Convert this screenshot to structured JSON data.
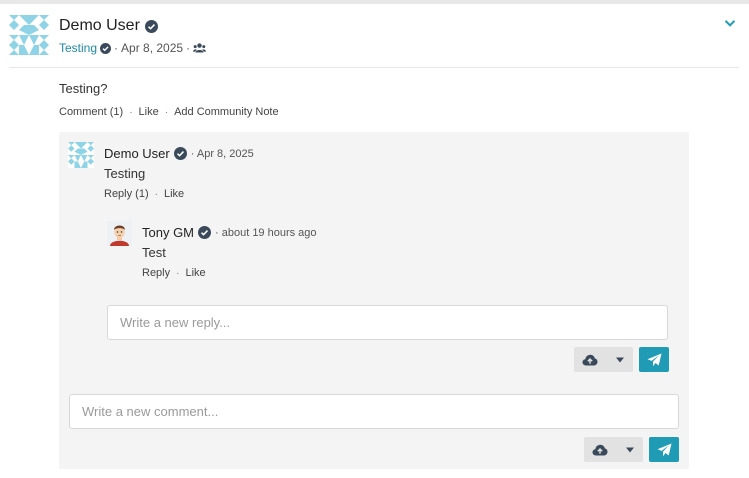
{
  "post": {
    "author": "Demo User",
    "group": "Testing",
    "date": "Apr 8, 2025",
    "body": "Testing?",
    "actions": {
      "comment": "Comment (1)",
      "like": "Like",
      "community_note": "Add Community Note"
    }
  },
  "comment": {
    "author": "Demo User",
    "date": "· Apr 8, 2025",
    "text": "Testing",
    "actions": {
      "reply": "Reply (1)",
      "like": "Like"
    }
  },
  "reply": {
    "author": "Tony GM",
    "date": "· about 19 hours ago",
    "text": "Test",
    "actions": {
      "reply": "Reply",
      "like": "Like"
    }
  },
  "reply_input": {
    "placeholder": "Write a new reply..."
  },
  "comment_input": {
    "placeholder": "Write a new comment..."
  },
  "separators": {
    "dot": "·"
  },
  "colors": {
    "accent": "#1f9bb5",
    "link": "#1f8aa8",
    "panel": "#f4f4f4",
    "badge": "#3b4a5a"
  },
  "icons": {
    "verified": "verified-check-icon",
    "group": "users-icon",
    "chevron": "chevron-down-icon",
    "upload": "cloud-upload-icon",
    "caret": "caret-down-icon",
    "send": "paper-plane-icon"
  }
}
